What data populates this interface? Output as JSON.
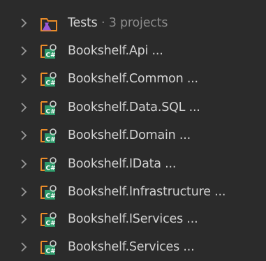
{
  "tree": {
    "folder": {
      "name": "Tests",
      "separator": "·",
      "count_label": "3 projects",
      "icon": "folder-flask-icon"
    },
    "projects": [
      {
        "label": "Bookshelf.Api ...",
        "icon": "csharp-project-icon"
      },
      {
        "label": "Bookshelf.Common ...",
        "icon": "csharp-project-icon"
      },
      {
        "label": "Bookshelf.Data.SQL ...",
        "icon": "csharp-project-icon"
      },
      {
        "label": "Bookshelf.Domain ...",
        "icon": "csharp-project-icon"
      },
      {
        "label": "Bookshelf.IData ...",
        "icon": "csharp-project-icon"
      },
      {
        "label": "Bookshelf.Infrastructure ...",
        "icon": "csharp-project-icon"
      },
      {
        "label": "Bookshelf.IServices ...",
        "icon": "csharp-project-icon"
      },
      {
        "label": "Bookshelf.Services ...",
        "icon": "csharp-project-icon"
      }
    ],
    "colors": {
      "background": "#2b2b2b",
      "text": "#d3d3d3",
      "muted_text": "#8c8c8c",
      "chevron": "#9a9a9a",
      "folder_orange": "#e98c2a",
      "flask_purple": "#9b59d6",
      "csharp_green": "#2e9a6a"
    }
  }
}
